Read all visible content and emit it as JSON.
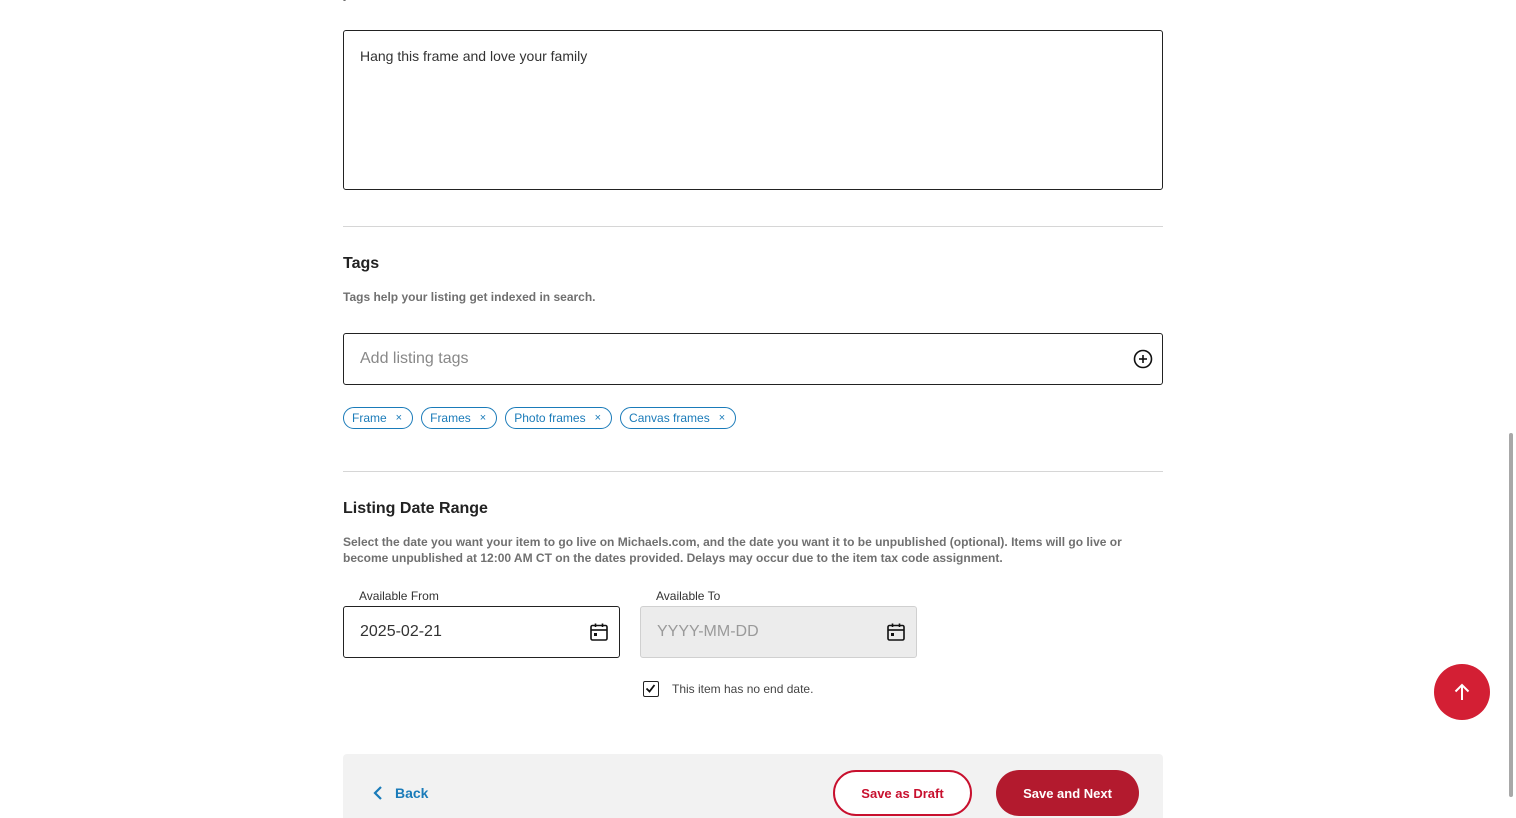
{
  "description": {
    "text": "Hang this frame and love your family"
  },
  "tags": {
    "title": "Tags",
    "help_text": "Tags help your listing get indexed in search.",
    "input_placeholder": "Add listing tags",
    "add_icon": "plus-circle-icon",
    "items": [
      {
        "label": "Frame",
        "remove": "×"
      },
      {
        "label": "Frames",
        "remove": "×"
      },
      {
        "label": "Photo frames",
        "remove": "×"
      },
      {
        "label": "Canvas frames",
        "remove": "×"
      }
    ]
  },
  "date_range": {
    "title": "Listing Date Range",
    "help_text_line1": "Select the date you want your item to go live on Michaels.com, and the date you want it to be unpublished (optional). Items will go live or",
    "help_text_line2": "become unpublished at 12:00 AM CT on the dates provided. Delays may occur due to the item tax code assignment.",
    "from_label": "Available From",
    "from_value": "2025-02-21",
    "to_label": "Available To",
    "to_placeholder": "YYYY-MM-DD",
    "calendar_icon": "calendar-icon",
    "no_end_date_label": "This item has no end date.",
    "no_end_date_checked": true
  },
  "footer": {
    "back_label": "Back",
    "save_draft_label": "Save as Draft",
    "save_next_label": "Save and Next"
  },
  "colors": {
    "accent_blue": "#1a7bb9",
    "brand_red": "#c8102e",
    "button_red": "#b31a2e",
    "fab_red": "#d31f34"
  }
}
